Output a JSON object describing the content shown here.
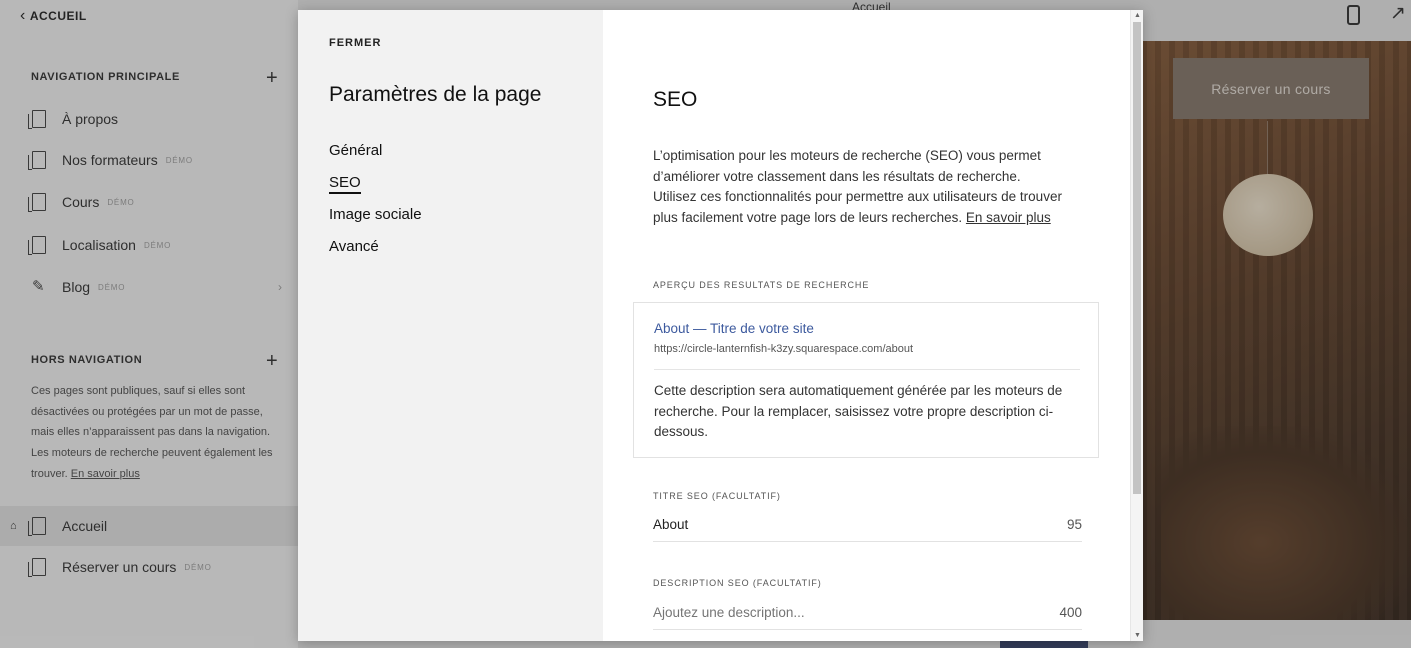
{
  "background": {
    "back_label": "ACCUEIL",
    "nav_section_title": "NAVIGATION PRINCIPALE",
    "nav_items": [
      {
        "label": "À propos",
        "badge": ""
      },
      {
        "label": "Nos formateurs",
        "badge": "DÉMO"
      },
      {
        "label": "Cours",
        "badge": "DÉMO"
      },
      {
        "label": "Localisation",
        "badge": "DÉMO"
      },
      {
        "label": "Blog",
        "badge": "DÉMO"
      }
    ],
    "hors_section_title": "HORS NAVIGATION",
    "hors_text": "Ces pages sont publiques, sauf si elles sont désactivées ou protégées par un mot de passe, mais elles n’apparaissent pas dans la navigation. Les moteurs de recherche peuvent également les trouver.",
    "hors_link": "En savoir plus",
    "hors_items": [
      {
        "label": "Accueil",
        "badge": ""
      },
      {
        "label": "Réserver un cours",
        "badge": "DÉMO"
      }
    ],
    "top_title": "Accueil",
    "hero_button": "Réserver un cours"
  },
  "modal": {
    "close_label": "FERMER",
    "title": "Paramètres de la page",
    "nav": [
      "Général",
      "SEO",
      "Image sociale",
      "Avancé"
    ],
    "active_nav": "SEO",
    "seo_heading": "SEO",
    "intro_text": "L’optimisation pour les moteurs de recherche (SEO) vous permet d’améliorer votre classement dans les résultats de recherche. Utilisez ces fonctionnalités pour permettre aux utilisateurs de trouver plus facilement votre page lors de leurs recherches.",
    "intro_link": "En savoir plus",
    "preview_label": "APERÇU DES RESULTATS DE RECHERCHE",
    "preview": {
      "title": "About — Titre de votre site",
      "url": "https://circle-lanternfish-k3zy.squarespace.com/about",
      "description": "Cette description sera automatiquement générée par les moteurs de recherche. Pour la remplacer, saisissez votre propre description ci-dessous."
    },
    "seo_title_label": "TITRE SEO (FACULTATIF)",
    "seo_title_value": "About",
    "seo_title_count": "95",
    "seo_desc_label": "DESCRIPTION SEO (FACULTATIF)",
    "seo_desc_placeholder": "Ajoutez une description...",
    "seo_desc_count": "400"
  }
}
